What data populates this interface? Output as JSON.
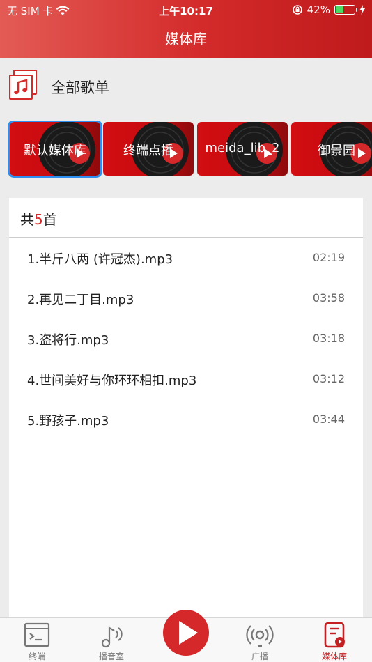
{
  "status_bar": {
    "carrier": "无 SIM 卡",
    "time": "上午10:17",
    "battery": "42%",
    "battery_level": 0.42
  },
  "nav": {
    "title": "媒体库"
  },
  "all_playlists": {
    "label": "全部歌单",
    "icon": "music-note-icon"
  },
  "libraries": [
    {
      "name": "默认媒体库",
      "selected": true
    },
    {
      "name": "终端点播",
      "selected": false
    },
    {
      "name": "meida_lib_2",
      "selected": false
    },
    {
      "name": "御景园",
      "selected": false
    }
  ],
  "song_list": {
    "count_prefix": "共",
    "count": "5",
    "count_suffix": "首",
    "songs": [
      {
        "title": "1.半斤八两 (许冠杰).mp3",
        "duration": "02:19"
      },
      {
        "title": "2.再见二丁目.mp3",
        "duration": "03:58"
      },
      {
        "title": "3.盗将行.mp3",
        "duration": "03:18"
      },
      {
        "title": "4.世间美好与你环环相扣.mp3",
        "duration": "03:12"
      },
      {
        "title": "5.野孩子.mp3",
        "duration": "03:44"
      }
    ]
  },
  "tabbar": {
    "items": [
      {
        "label": "终端",
        "icon": "terminal-icon"
      },
      {
        "label": "播音室",
        "icon": "music-broadcast-icon"
      },
      {
        "label": "",
        "icon": "play-icon"
      },
      {
        "label": "广播",
        "icon": "broadcast-icon"
      },
      {
        "label": "媒体库",
        "icon": "media-library-icon"
      }
    ],
    "active_color": "#c41f22"
  },
  "colors": {
    "accent": "#d32a2a",
    "selected_border": "#2e8ff0"
  }
}
